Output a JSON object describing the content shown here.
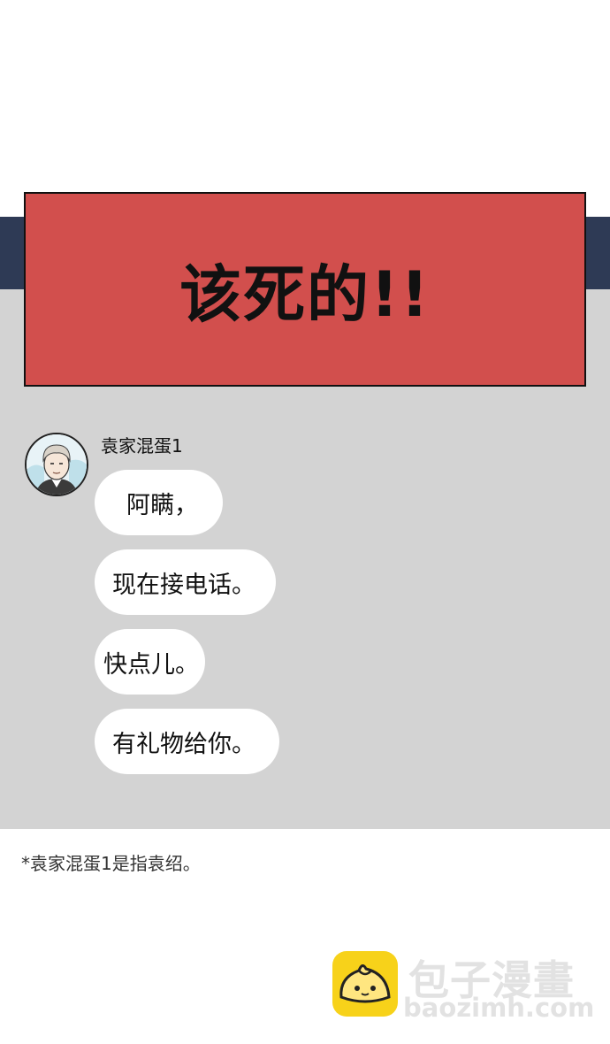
{
  "panel": {
    "exclamation": "该死的!!"
  },
  "chat": {
    "sender": "袁家混蛋1",
    "messages": [
      "阿瞒，",
      "现在接电话。",
      "快点儿。",
      "有礼物给你。"
    ]
  },
  "footnote": "*袁家混蛋1是指袁绍。",
  "watermark": {
    "title": "包子漫畫",
    "url": "baozimh.com"
  },
  "colors": {
    "alert_red": "#d24f4d",
    "navy": "#2e3a55",
    "chat_bg": "#d3d3d3",
    "logo_yellow": "#f7d21a"
  },
  "icons": [
    "avatar-portrait",
    "bun-logo-icon"
  ]
}
